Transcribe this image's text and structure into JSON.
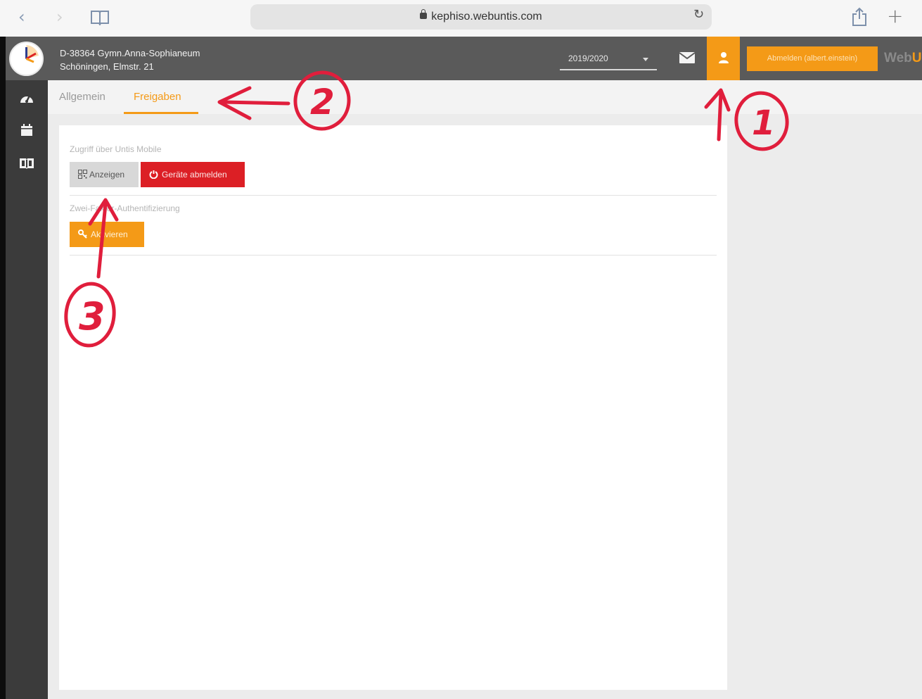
{
  "browser": {
    "url": "kephiso.webuntis.com",
    "icons": [
      "back-icon",
      "forward-icon",
      "bookmarks-icon",
      "lock-icon",
      "reload-icon",
      "share-icon",
      "new-tab-icon"
    ]
  },
  "header": {
    "school_line1": "D-38364 Gymn.Anna-Sophianeum",
    "school_line2": "Schöningen, Elmstr. 21",
    "school_year": "2019/2020",
    "logout_label": "Abmelden (albert.einstein)",
    "brand_prefix": "Web",
    "brand_suffix": "U",
    "accent_color": "#f49a17",
    "header_color": "#5a5a5a"
  },
  "sidebar": {
    "items": [
      {
        "icon": "dashboard-icon"
      },
      {
        "icon": "calendar-icon"
      },
      {
        "icon": "book-icon"
      }
    ]
  },
  "tabs": [
    {
      "label": "Allgemein",
      "active": false
    },
    {
      "label": "Freigaben",
      "active": true
    }
  ],
  "sections": {
    "mobile_access_label": "Zugriff über Untis Mobile",
    "show_button": "Anzeigen",
    "logout_devices_button": "Geräte abmelden",
    "two_factor_label": "Zwei-Faktor-Authentifizierung",
    "activate_button": "Aktivieren",
    "danger_color": "#dc1f25"
  },
  "annotations": {
    "marker_1": "1",
    "marker_2": "2",
    "marker_3": "3",
    "ink_color": "#e01e3c"
  }
}
